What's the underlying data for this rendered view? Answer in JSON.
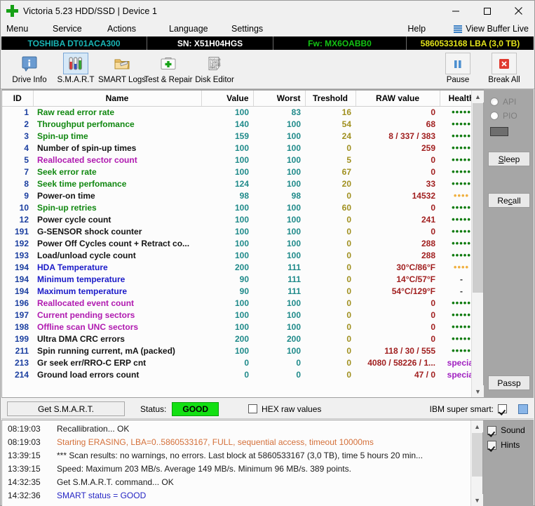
{
  "window": {
    "title": "Victoria 5.23 HDD/SSD | Device 1",
    "icon": "green-cross-icon",
    "minimize": "minimize-icon",
    "maximize": "maximize-icon",
    "close": "close-icon"
  },
  "menu": {
    "items": [
      "Menu",
      "Service",
      "Actions",
      "Language",
      "Settings",
      "Help"
    ],
    "view_buffer_live": "View Buffer Live"
  },
  "device_bar": {
    "model": "TOSHIBA DT01ACA300",
    "serial": "SN: X51H04HGS",
    "firmware": "Fw: MX6OABB0",
    "capacity": "5860533168 LBA (3,0 TB)",
    "colors": {
      "model": "#19b5b5",
      "serial": "#ffffff",
      "firmware": "#13c413",
      "capacity": "#e2e21a"
    }
  },
  "toolbar": {
    "items": [
      {
        "label": "Drive Info",
        "icon": "drive-info-icon",
        "selected": false
      },
      {
        "label": "S.M.A.R.T",
        "icon": "smart-test-tubes-icon",
        "selected": true
      },
      {
        "label": "SMART Logs",
        "icon": "smart-logs-folder-icon",
        "selected": false
      },
      {
        "label": "Test & Repair",
        "icon": "first-aid-kit-icon",
        "selected": false
      },
      {
        "label": "Disk Editor",
        "icon": "binary-document-icon",
        "selected": false
      }
    ],
    "right_items": [
      {
        "label": "Pause",
        "icon": "pause-icon"
      },
      {
        "label": "Break All",
        "icon": "red-x-icon"
      }
    ]
  },
  "table": {
    "columns": [
      "ID",
      "Name",
      "Value",
      "Worst",
      "Treshold",
      "RAW value",
      "Health"
    ],
    "rows": [
      {
        "id": "1",
        "name": "Raw read error rate",
        "name_color": "green",
        "value": "100",
        "worst": "83",
        "thr": "16",
        "raw": "0",
        "health": "5-green"
      },
      {
        "id": "2",
        "name": "Throughput perfomance",
        "name_color": "green",
        "value": "140",
        "worst": "100",
        "thr": "54",
        "raw": "68",
        "health": "5-green"
      },
      {
        "id": "3",
        "name": "Spin-up time",
        "name_color": "green",
        "value": "159",
        "worst": "100",
        "thr": "24",
        "raw": "8 / 337 / 383",
        "health": "5-green"
      },
      {
        "id": "4",
        "name": "Number of spin-up times",
        "name_color": "black",
        "value": "100",
        "worst": "100",
        "thr": "0",
        "raw": "259",
        "health": "5-green"
      },
      {
        "id": "5",
        "name": "Reallocated sector count",
        "name_color": "purple",
        "value": "100",
        "worst": "100",
        "thr": "5",
        "raw": "0",
        "health": "5-green"
      },
      {
        "id": "7",
        "name": "Seek error rate",
        "name_color": "green",
        "value": "100",
        "worst": "100",
        "thr": "67",
        "raw": "0",
        "health": "5-green"
      },
      {
        "id": "8",
        "name": "Seek time perfomance",
        "name_color": "green",
        "value": "124",
        "worst": "100",
        "thr": "20",
        "raw": "33",
        "health": "5-green"
      },
      {
        "id": "9",
        "name": "Power-on time",
        "name_color": "black",
        "value": "98",
        "worst": "98",
        "thr": "0",
        "raw": "14532",
        "health": "4-orange"
      },
      {
        "id": "10",
        "name": "Spin-up retries",
        "name_color": "green",
        "value": "100",
        "worst": "100",
        "thr": "60",
        "raw": "0",
        "health": "5-green"
      },
      {
        "id": "12",
        "name": "Power cycle count",
        "name_color": "black",
        "value": "100",
        "worst": "100",
        "thr": "0",
        "raw": "241",
        "health": "5-green"
      },
      {
        "id": "191",
        "name": "G-SENSOR shock counter",
        "name_color": "black",
        "value": "100",
        "worst": "100",
        "thr": "0",
        "raw": "0",
        "health": "5-green"
      },
      {
        "id": "192",
        "name": "Power Off Cycles count + Retract co...",
        "name_color": "black",
        "value": "100",
        "worst": "100",
        "thr": "0",
        "raw": "288",
        "health": "5-green"
      },
      {
        "id": "193",
        "name": "Load/unload cycle count",
        "name_color": "black",
        "value": "100",
        "worst": "100",
        "thr": "0",
        "raw": "288",
        "health": "5-green"
      },
      {
        "id": "194",
        "name": "HDA Temperature",
        "name_color": "blue",
        "value": "200",
        "worst": "111",
        "thr": "0",
        "raw": "30°C/86°F",
        "health": "4-orange"
      },
      {
        "id": "194",
        "name": "Minimum temperature",
        "name_color": "blue",
        "value": "90",
        "worst": "111",
        "thr": "0",
        "raw": "14°C/57°F",
        "health": "dash"
      },
      {
        "id": "194",
        "name": "Maximum temperature",
        "name_color": "blue",
        "value": "90",
        "worst": "111",
        "thr": "0",
        "raw": "54°C/129°F",
        "health": "dash"
      },
      {
        "id": "196",
        "name": "Reallocated event count",
        "name_color": "purple",
        "value": "100",
        "worst": "100",
        "thr": "0",
        "raw": "0",
        "health": "5-green"
      },
      {
        "id": "197",
        "name": "Current pending sectors",
        "name_color": "purple",
        "value": "100",
        "worst": "100",
        "thr": "0",
        "raw": "0",
        "health": "5-green"
      },
      {
        "id": "198",
        "name": "Offline scan UNC sectors",
        "name_color": "purple",
        "value": "100",
        "worst": "100",
        "thr": "0",
        "raw": "0",
        "health": "5-green"
      },
      {
        "id": "199",
        "name": "Ultra DMA CRC errors",
        "name_color": "black",
        "value": "200",
        "worst": "200",
        "thr": "0",
        "raw": "0",
        "health": "5-green"
      },
      {
        "id": "211",
        "name": "Spin running current, mA (packed)",
        "name_color": "black",
        "value": "100",
        "worst": "100",
        "thr": "0",
        "raw": "118 / 30 / 555",
        "health": "5-green"
      },
      {
        "id": "213",
        "name": "Gr seek err/RRO-C ERP cnt",
        "name_color": "black",
        "value": "0",
        "worst": "0",
        "thr": "0",
        "raw": "4080 / 58226 / 1...",
        "health": "special"
      },
      {
        "id": "214",
        "name": "Ground load errors count",
        "name_color": "black",
        "value": "0",
        "worst": "0",
        "thr": "0",
        "raw": "47 / 0",
        "health": "special"
      }
    ]
  },
  "sidebar": {
    "api_label": "API",
    "pio_label": "PIO",
    "indicator": "progress-indicator",
    "sleep_label": "Sleep",
    "recall_label": "Recall",
    "passp_label": "Passp"
  },
  "status_strip": {
    "get_smart_label": "Get S.M.A.R.T.",
    "status_label": "Status:",
    "status_value": "GOOD",
    "status_color": "#13e013",
    "hex_raw_label": "HEX raw values",
    "hex_raw_checked": false,
    "ibm_super_smart_label": "IBM super smart:",
    "ibm_super_smart_checked": true,
    "color_swatch": "#8ab6e8"
  },
  "log": {
    "lines": [
      {
        "time": "08:19:03",
        "msg": "Recallibration... OK",
        "color": "black"
      },
      {
        "time": "08:19:03",
        "msg": "Starting ERASING, LBA=0..5860533167, FULL, sequential access, timeout 10000ms",
        "color": "orange"
      },
      {
        "time": "13:39:15",
        "msg": "*** Scan results: no warnings, no errors. Last block at 5860533167 (3,0 TB), time 5 hours 20 min...",
        "color": "black"
      },
      {
        "time": "13:39:15",
        "msg": "Speed: Maximum 203 MB/s. Average 149 MB/s. Minimum 96 MB/s. 389 points.",
        "color": "black"
      },
      {
        "time": "14:32:35",
        "msg": "Get S.M.A.R.T. command... OK",
        "color": "black"
      },
      {
        "time": "14:32:36",
        "msg": "SMART status = GOOD",
        "color": "blue"
      }
    ],
    "panel": {
      "sound_label": "Sound",
      "sound_checked": true,
      "hints_label": "Hints",
      "hints_checked": true
    }
  }
}
